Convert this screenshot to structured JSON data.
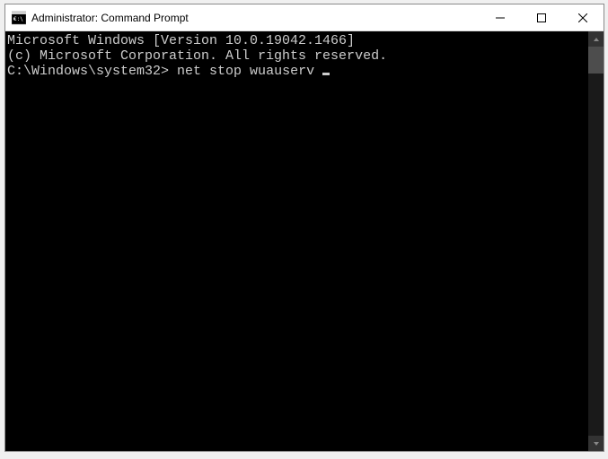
{
  "window": {
    "title": "Administrator: Command Prompt"
  },
  "terminal": {
    "line1": "Microsoft Windows [Version 10.0.19042.1466]",
    "line2": "(c) Microsoft Corporation. All rights reserved.",
    "blank1": "",
    "prompt": "C:\\Windows\\system32>",
    "command": "net stop wuauserv"
  }
}
